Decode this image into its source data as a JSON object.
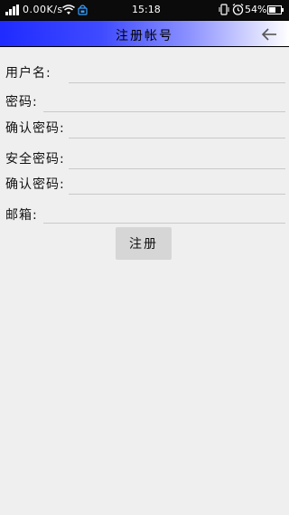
{
  "status_bar": {
    "network_speed": "0.00K/s",
    "time": "15:18",
    "battery_percent": "54%",
    "icons": [
      "signal-icon",
      "wifi-icon",
      "lock-badge-icon",
      "vibrate-icon",
      "alarm-icon",
      "battery-icon"
    ]
  },
  "header": {
    "title": "注册帐号",
    "back_icon": "arrow-left-icon"
  },
  "form": {
    "username_label": "用户名:",
    "password_label": "密码:",
    "confirm_password_label": "确认密码:",
    "security_password_label": "安全密码:",
    "confirm_security_password_label": "确认密码:",
    "email_label": "邮箱:",
    "username_value": "",
    "password_value": "",
    "confirm_password_value": "",
    "security_password_value": "",
    "confirm_security_password_value": "",
    "email_value": ""
  },
  "actions": {
    "register_label": "注册"
  },
  "colors": {
    "header_gradient_start": "#1f2bff",
    "header_gradient_end": "#ffffff",
    "background": "#efefef",
    "button_bg": "#d6d6d6"
  }
}
